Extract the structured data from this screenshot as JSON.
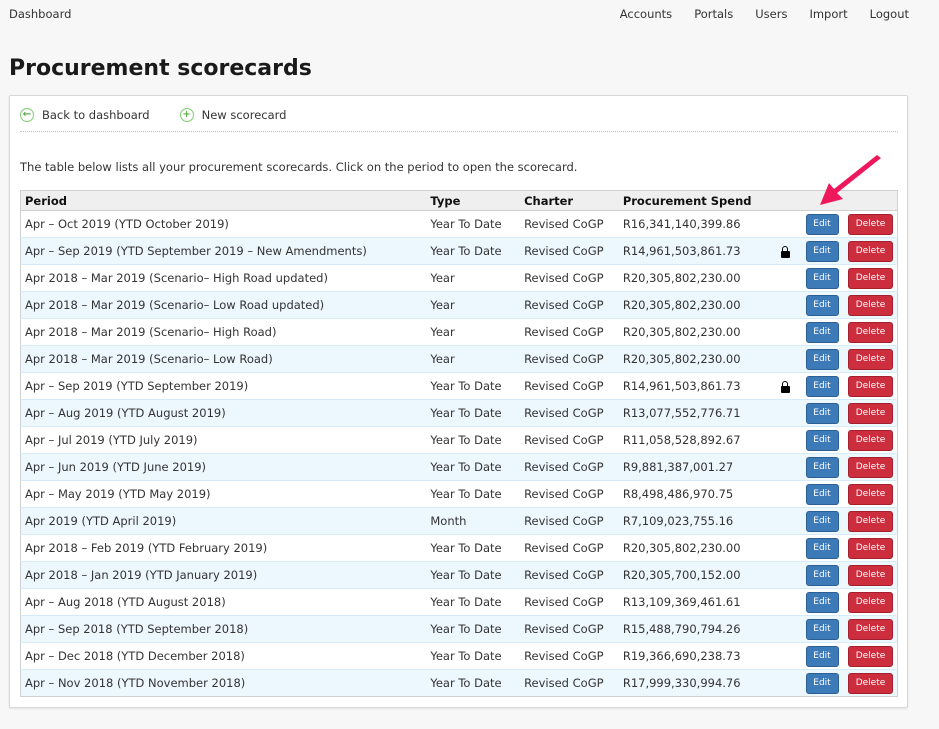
{
  "topbar": {
    "brand": "Dashboard",
    "nav": [
      "Accounts",
      "Portals",
      "Users",
      "Import",
      "Logout"
    ]
  },
  "page": {
    "title": "Procurement scorecards",
    "actions": {
      "back": {
        "label": "Back to dashboard",
        "icon": "arrow-left-circle-icon"
      },
      "new": {
        "label": "New scorecard",
        "icon": "plus-circle-icon"
      }
    },
    "intro": "The table below lists all your procurement scorecards. Click on the period to open the scorecard."
  },
  "table": {
    "columns": [
      "Period",
      "Type",
      "Charter",
      "Procurement Spend",
      "",
      "",
      ""
    ],
    "edit_label": "Edit",
    "delete_label": "Delete",
    "rows": [
      {
        "period": "Apr – Oct 2019 (YTD October 2019)",
        "type": "Year To Date",
        "charter": "Revised CoGP",
        "spend": "R16,341,140,399.86",
        "locked": false
      },
      {
        "period": "Apr – Sep 2019 (YTD September 2019 – New Amendments)",
        "type": "Year To Date",
        "charter": "Revised CoGP",
        "spend": "R14,961,503,861.73",
        "locked": true
      },
      {
        "period": "Apr 2018 – Mar 2019 (Scenario– High Road updated)",
        "type": "Year",
        "charter": "Revised CoGP",
        "spend": "R20,305,802,230.00",
        "locked": false
      },
      {
        "period": "Apr 2018 – Mar 2019 (Scenario– Low Road updated)",
        "type": "Year",
        "charter": "Revised CoGP",
        "spend": "R20,305,802,230.00",
        "locked": false
      },
      {
        "period": "Apr 2018 – Mar 2019 (Scenario– High Road)",
        "type": "Year",
        "charter": "Revised CoGP",
        "spend": "R20,305,802,230.00",
        "locked": false
      },
      {
        "period": "Apr 2018 – Mar 2019 (Scenario– Low Road)",
        "type": "Year",
        "charter": "Revised CoGP",
        "spend": "R20,305,802,230.00",
        "locked": false
      },
      {
        "period": "Apr – Sep 2019 (YTD September 2019)",
        "type": "Year To Date",
        "charter": "Revised CoGP",
        "spend": "R14,961,503,861.73",
        "locked": true
      },
      {
        "period": "Apr – Aug 2019 (YTD August 2019)",
        "type": "Year To Date",
        "charter": "Revised CoGP",
        "spend": "R13,077,552,776.71",
        "locked": false
      },
      {
        "period": "Apr – Jul 2019 (YTD July 2019)",
        "type": "Year To Date",
        "charter": "Revised CoGP",
        "spend": "R11,058,528,892.67",
        "locked": false
      },
      {
        "period": "Apr – Jun 2019 (YTD June 2019)",
        "type": "Year To Date",
        "charter": "Revised CoGP",
        "spend": "R9,881,387,001.27",
        "locked": false
      },
      {
        "period": "Apr – May 2019 (YTD May 2019)",
        "type": "Year To Date",
        "charter": "Revised CoGP",
        "spend": "R8,498,486,970.75",
        "locked": false
      },
      {
        "period": "Apr 2019 (YTD April 2019)",
        "type": "Month",
        "charter": "Revised CoGP",
        "spend": "R7,109,023,755.16",
        "locked": false
      },
      {
        "period": "Apr 2018 – Feb 2019 (YTD February 2019)",
        "type": "Year To Date",
        "charter": "Revised CoGP",
        "spend": "R20,305,802,230.00",
        "locked": false
      },
      {
        "period": "Apr 2018 – Jan 2019 (YTD January 2019)",
        "type": "Year To Date",
        "charter": "Revised CoGP",
        "spend": "R20,305,700,152.00",
        "locked": false
      },
      {
        "period": "Apr – Aug 2018 (YTD August 2018)",
        "type": "Year To Date",
        "charter": "Revised CoGP",
        "spend": "R13,109,369,461.61",
        "locked": false
      },
      {
        "period": "Apr – Sep 2018 (YTD September 2018)",
        "type": "Year To Date",
        "charter": "Revised CoGP",
        "spend": "R15,488,790,794.26",
        "locked": false
      },
      {
        "period": "Apr – Dec 2018 (YTD December 2018)",
        "type": "Year To Date",
        "charter": "Revised CoGP",
        "spend": "R19,366,690,238.73",
        "locked": false
      },
      {
        "period": "Apr – Nov 2018 (YTD November 2018)",
        "type": "Year To Date",
        "charter": "Revised CoGP",
        "spend": "R17,999,330,994.76",
        "locked": false
      }
    ]
  },
  "annotation": {
    "type": "arrow",
    "target": "first row Edit button",
    "color": "#f0185c"
  },
  "colors": {
    "edit_button": "#3d7ab8",
    "delete_button": "#cc2e3e",
    "row_alt": "#edf7fe",
    "icon_green": "#7ccc6a"
  }
}
